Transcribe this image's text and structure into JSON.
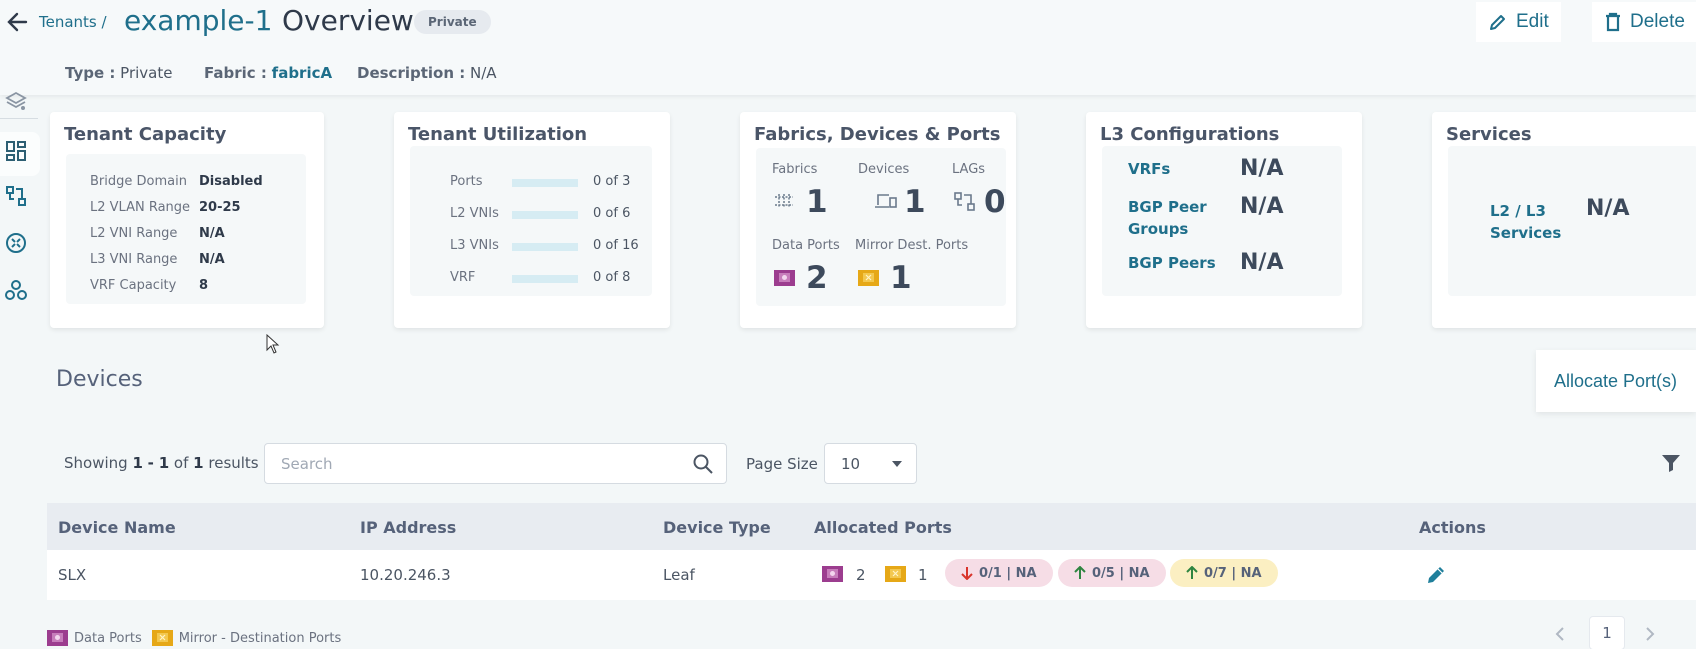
{
  "header": {
    "breadcrumb": "Tenants /",
    "tenant_name": "example-1",
    "page_title": "Overview",
    "badge": "Private",
    "edit_label": "Edit",
    "delete_label": "Delete"
  },
  "meta": {
    "type_label": "Type :",
    "type_value": "Private",
    "fabric_label": "Fabric :",
    "fabric_value": "fabricA",
    "description_label": "Description :",
    "description_value": "N/A"
  },
  "sidebar": {
    "items": [
      {
        "icon": "layers-icon"
      },
      {
        "icon": "dashboard-icon",
        "active": true
      },
      {
        "icon": "topology-icon"
      },
      {
        "icon": "router-icon"
      },
      {
        "icon": "network-nodes-icon"
      }
    ]
  },
  "tenant_capacity": {
    "title": "Tenant Capacity",
    "rows": [
      {
        "key": "Bridge Domain",
        "value": "Disabled"
      },
      {
        "key": "L2 VLAN Range",
        "value": "20-25"
      },
      {
        "key": "L2 VNI Range",
        "value": "N/A"
      },
      {
        "key": "L3 VNI Range",
        "value": "N/A"
      },
      {
        "key": "VRF Capacity",
        "value": "8"
      }
    ]
  },
  "tenant_utilization": {
    "title": "Tenant Utilization",
    "rows": [
      {
        "label": "Ports",
        "used": 0,
        "total": 3,
        "text": "0 of 3"
      },
      {
        "label": "L2 VNIs",
        "used": 0,
        "total": 6,
        "text": "0 of 6"
      },
      {
        "label": "L3 VNIs",
        "used": 0,
        "total": 16,
        "text": "0 of 16"
      },
      {
        "label": "VRF",
        "used": 0,
        "total": 8,
        "text": "0 of 8"
      }
    ]
  },
  "fabrics_devices_ports": {
    "title": "Fabrics, Devices & Ports",
    "fabrics_label": "Fabrics",
    "fabrics_value": "1",
    "devices_label": "Devices",
    "devices_value": "1",
    "lags_label": "LAGs",
    "lags_value": "0",
    "data_ports_label": "Data Ports",
    "data_ports_value": "2",
    "mirror_label": "Mirror Dest. Ports",
    "mirror_value": "1"
  },
  "l3_configurations": {
    "title": "L3 Configurations",
    "rows": [
      {
        "key": "VRFs",
        "value": "N/A"
      },
      {
        "key_line1": "BGP Peer",
        "key_line2": "Groups",
        "value": "N/A"
      },
      {
        "key": "BGP Peers",
        "value": "N/A"
      }
    ]
  },
  "services": {
    "title": "Services",
    "key_line1": "L2 / L3",
    "key_line2": "Services",
    "value": "N/A"
  },
  "devices": {
    "title": "Devices",
    "allocate_label": "Allocate Port(s)",
    "showing_prefix": "Showing",
    "showing_from": "1",
    "showing_sep": "-",
    "showing_to": "1",
    "showing_of": "of",
    "showing_total": "1",
    "showing_suffix": "results",
    "search_placeholder": "Search",
    "search_value": "",
    "page_size_label": "Page Size",
    "page_size_value": "10",
    "columns": [
      "Device Name",
      "IP Address",
      "Device Type",
      "Allocated Ports",
      "Actions"
    ],
    "rows": [
      {
        "name": "SLX",
        "ip": "10.20.246.3",
        "type": "Leaf",
        "data_ports": "2",
        "mirror_ports": "1",
        "pills": [
          {
            "dir": "down",
            "text": "0/1 | NA",
            "bg": "#f6dde6",
            "arrow": "#d9342b"
          },
          {
            "dir": "up",
            "text": "0/5 | NA",
            "bg": "#f6dde6",
            "arrow": "#2e8540"
          },
          {
            "dir": "up",
            "text": "0/7 | NA",
            "bg": "#fbefc2",
            "arrow": "#2e8540"
          }
        ]
      }
    ],
    "legend_data": "Data Ports",
    "legend_mirror": "Mirror - Destination Ports",
    "current_page": "1"
  },
  "colors": {
    "accent": "#1f6f8b",
    "data_port": "#9c3d8f",
    "mirror_port": "#e6a817"
  }
}
